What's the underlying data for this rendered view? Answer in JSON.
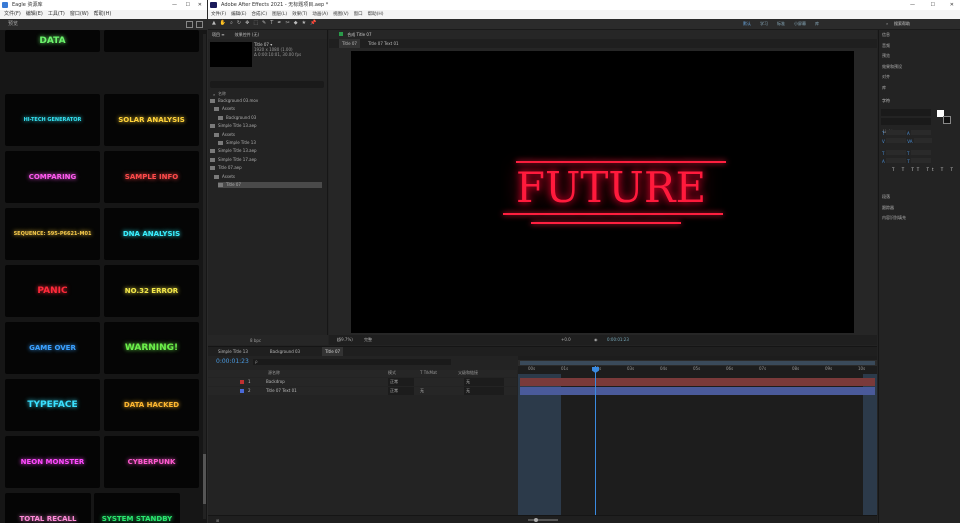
{
  "browser": {
    "title": "Eagle 资源库",
    "menu": [
      "文件(F)",
      "编辑(E)",
      "工具(T)",
      "窗口(W)",
      "帮助(H)"
    ],
    "toolbar_label": "预览",
    "thumbs": [
      {
        "text": "DATA",
        "color": "#6cf56c"
      },
      {
        "text": "",
        "color": "#4aa3ff"
      },
      {
        "text": "HI-TECH GENERATOR",
        "color": "#35e0f0"
      },
      {
        "text": "SOLAR ANALYSIS",
        "color": "#ffd23a"
      },
      {
        "text": "COMPARING",
        "color": "#ff5af0"
      },
      {
        "text": "SAMPLE INFO",
        "color": "#ff4a4a"
      },
      {
        "text": "SEQUENCE: 595-P6621-M01",
        "color": "#f4c84a"
      },
      {
        "text": "DNA ANALYSIS",
        "color": "#3af0ff"
      },
      {
        "text": "PANIC",
        "color": "#ff2a3a"
      },
      {
        "text": "NO.32 ERROR",
        "color": "#f4e84a"
      },
      {
        "text": "GAME OVER",
        "color": "#3aa0ff"
      },
      {
        "text": "WARNING!",
        "color": "#6cf04a"
      },
      {
        "text": "TYPEFACE",
        "color": "#3ae0ff"
      },
      {
        "text": "DATA HACKED",
        "color": "#ffb830"
      },
      {
        "text": "NEON MONSTER",
        "color": "#ff4aff"
      },
      {
        "text": "CYBERPUNK",
        "color": "#ff5ad0"
      },
      {
        "text": "TOTAL RECALL",
        "color": "#ff8ad8"
      },
      {
        "text": "SYSTEM STANDBY",
        "color": "#2ae870"
      }
    ]
  },
  "ae": {
    "title": "Adobe After Effects 2021 - 无标题项目.aep *",
    "menu": [
      "文件(F)",
      "编辑(E)",
      "合成(C)",
      "图层(L)",
      "效果(T)",
      "动画(A)",
      "视图(V)",
      "窗口",
      "帮助(H)"
    ],
    "workspace": [
      "默认",
      "学习",
      "标准",
      "小屏幕",
      "库"
    ],
    "search_help": "搜索帮助",
    "project": {
      "tabs": "项目 ≡",
      "effect_controls": "效果控件 (无)",
      "selected_name": "Title 07 ▾",
      "selected_info1": "1920 x 1080 (1.00)",
      "selected_info2": "Δ 0:00:10:01, 30.00 fps",
      "col_name": "名称",
      "items": [
        "Background 03.mov",
        "Assets",
        "Background 03",
        "Simple Title 13.aep",
        "Assets",
        "Simple Title 13",
        "Simple Title 13.aep",
        "Simple Title 17.aep",
        "Title 07.aep",
        "Assets",
        "Title 07"
      ],
      "bpc": "8 bpc"
    },
    "comp": {
      "tab_label": "合成 Title 07",
      "sub_tabs": [
        "Title 07",
        "Title 07 Text 01"
      ],
      "title_text": "FUTURE",
      "zoom": "(69.7%)",
      "quality": "完整",
      "timecode": "0:00:01:23",
      "exposure": "+0.0"
    },
    "timeline": {
      "tabs": [
        "Simple Title 13",
        "Background 03",
        "Title 07"
      ],
      "timecode": "0:00:01:23",
      "search_placeholder": "ρ",
      "cols": [
        "源名称",
        "模式",
        "T TrkMat",
        "父级和链接"
      ],
      "layers": [
        {
          "num": "1",
          "name": "Backdrop",
          "mode": "正常",
          "trk": "",
          "parent": "无",
          "color": "#c03030"
        },
        {
          "num": "2",
          "name": "Title 07 Text 01",
          "mode": "正常",
          "trk": "无",
          "parent": "无",
          "color": "#4a6ad8"
        }
      ],
      "ruler": [
        "00s",
        "01s",
        "02s",
        "03s",
        "04s",
        "05s",
        "06s",
        "07s",
        "08s",
        "09s",
        "10s"
      ]
    },
    "right_panel": {
      "items": [
        "信息",
        "音频",
        "预览",
        "效果和预设",
        "对齐",
        "库"
      ],
      "character": "字符",
      "font": "微软雅黑",
      "style": "Light",
      "items2": [
        "段落",
        "跟踪器",
        "内容识别填充"
      ]
    }
  }
}
